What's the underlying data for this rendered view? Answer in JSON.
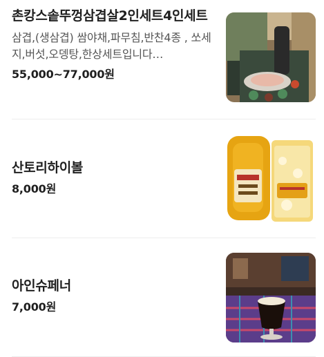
{
  "menu": {
    "items": [
      {
        "name": "촌캉스솥뚜껑삼겹살2인세트4인세트",
        "description": "삼겹,(생삼겹) 쌈야채,파무침,반찬4종 , 쏘세지,버섯,오뎅탕,한상세트입니다…",
        "price": "55,000~77,000원"
      },
      {
        "name": "산토리하이볼",
        "price": "8,000원"
      },
      {
        "name": "아인슈페너",
        "price": "7,000원"
      }
    ]
  }
}
